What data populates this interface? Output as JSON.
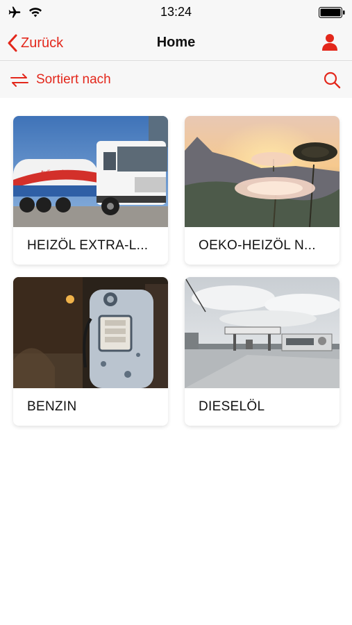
{
  "status_bar": {
    "time": "13:24",
    "icons": [
      "airplane-icon",
      "wifi-icon",
      "battery-icon"
    ]
  },
  "nav": {
    "back_label": "Zurück",
    "title": "Home",
    "profile_icon": "user-icon"
  },
  "sort_bar": {
    "sort_label": "Sortiert nach",
    "sort_icon": "swap-arrows-icon",
    "search_icon": "search-icon"
  },
  "colors": {
    "accent": "#e3271b",
    "bar_background": "#f7f7f7"
  },
  "products": [
    {
      "label": "HEIZÖL EXTRA-L...",
      "image": "tanker-truck-photo"
    },
    {
      "label": "OEKO-HEIZÖL N...",
      "image": "sunset-flowers-photo"
    },
    {
      "label": "BENZIN",
      "image": "old-fuel-pump-photo"
    },
    {
      "label": "DIESELÖL",
      "image": "gas-station-photo"
    }
  ]
}
